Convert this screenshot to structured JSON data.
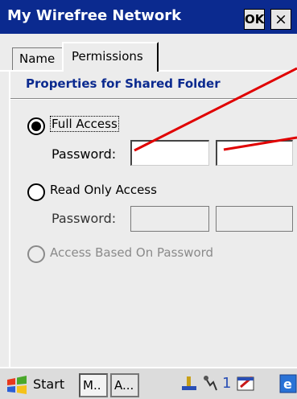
{
  "window": {
    "title": "My Wirefree Network",
    "ok_label": "OK",
    "close_label": "×"
  },
  "tabs": [
    {
      "label": "Name",
      "selected": false
    },
    {
      "label": "Permissions",
      "selected": true
    }
  ],
  "section_title": "Properties for Shared Folder",
  "options": {
    "full_access": {
      "label": "Full Access",
      "checked": true,
      "enabled": true
    },
    "full_password_label": "Password:",
    "full_password_value": "",
    "full_password_confirm_value": "",
    "read_only": {
      "label": "Read Only Access",
      "checked": false,
      "enabled": true
    },
    "read_password_label": "Password:",
    "read_password_value": "",
    "read_password_confirm_value": "",
    "based_on_password": {
      "label": "Access Based On Password",
      "checked": false,
      "enabled": false
    }
  },
  "taskbar": {
    "start_label": "Start",
    "tasks": [
      "M..",
      "A..."
    ],
    "tray": [
      "network-icon",
      "signal-icon",
      "1",
      "edit-icon",
      "ie-icon"
    ]
  },
  "colors": {
    "title_bar": "#0b2a8f",
    "section_title": "#0b2a8f",
    "annotation": "#e00000"
  }
}
